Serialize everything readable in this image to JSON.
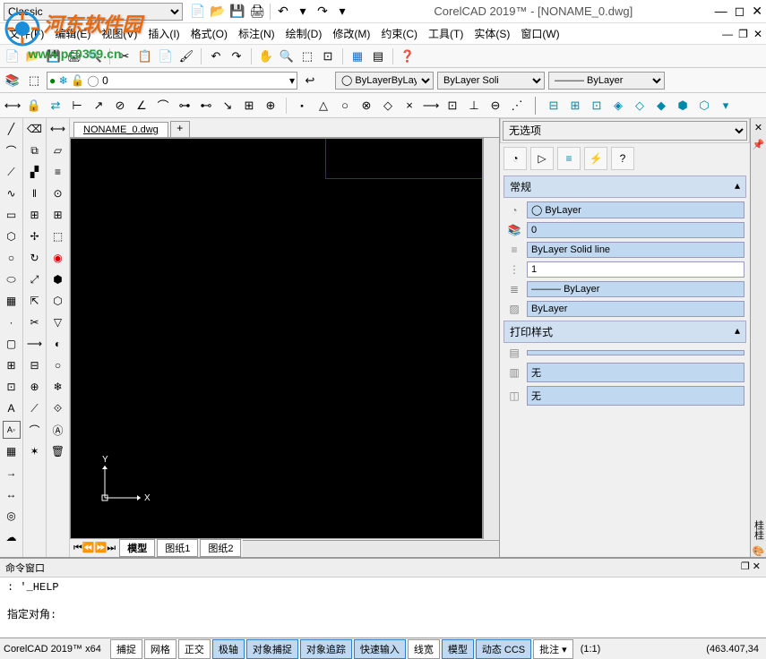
{
  "watermark": {
    "text": "河东软件园",
    "url": "www.pc0359.cn"
  },
  "title": {
    "workspace": "Classic",
    "app": "CorelCAD 2019™ - [NONAME_0.dwg]"
  },
  "menu": {
    "file": "文件(F)",
    "edit": "编辑(E)",
    "view": "视图(V)",
    "insert": "插入(I)",
    "format": "格式(O)",
    "annotate": "标注(N)",
    "draw": "绘制(D)",
    "modify": "修改(M)",
    "constrain": "约束(C)",
    "tools": "工具(T)",
    "solids": "实体(S)",
    "window": "窗口(W)"
  },
  "layers": {
    "current": "0"
  },
  "props_combos": {
    "color": "ByLayer",
    "linetype": "ByLayer    Soli",
    "lineweight": "ByLayer"
  },
  "tabs": {
    "file": "NONAME_0.dwg",
    "add": "+"
  },
  "sheets": {
    "model": "模型",
    "sheet1": "图纸1",
    "sheet2": "图纸2"
  },
  "properties": {
    "title": "无选项",
    "section_general": "常规",
    "color": "ByLayer",
    "layer": "0",
    "linetype": "ByLayer    Solid line",
    "scale": "1",
    "lineweight": "ByLayer",
    "transparency": "ByLayer",
    "section_print": "打印样式",
    "print_style": "",
    "print_none1": "无",
    "print_none2": "无"
  },
  "command": {
    "title": "命令窗口",
    "line1": ": '_HELP",
    "line2": "指定对角:"
  },
  "status": {
    "version": "CorelCAD 2019™ x64",
    "snap": "捕捉",
    "grid": "网格",
    "ortho": "正交",
    "polar": "极轴",
    "osnap": "对象捕捉",
    "otrack": "对象追踪",
    "quickinput": "快速输入",
    "lineweight": "线宽",
    "model": "模型",
    "dynccs": "动态 CCS",
    "annotate": "批注 ▾",
    "scale": "(1:1)",
    "coords": "(463.407,34"
  },
  "ucs": {
    "x": "X",
    "y": "Y"
  },
  "vertical_text": "桂桂"
}
